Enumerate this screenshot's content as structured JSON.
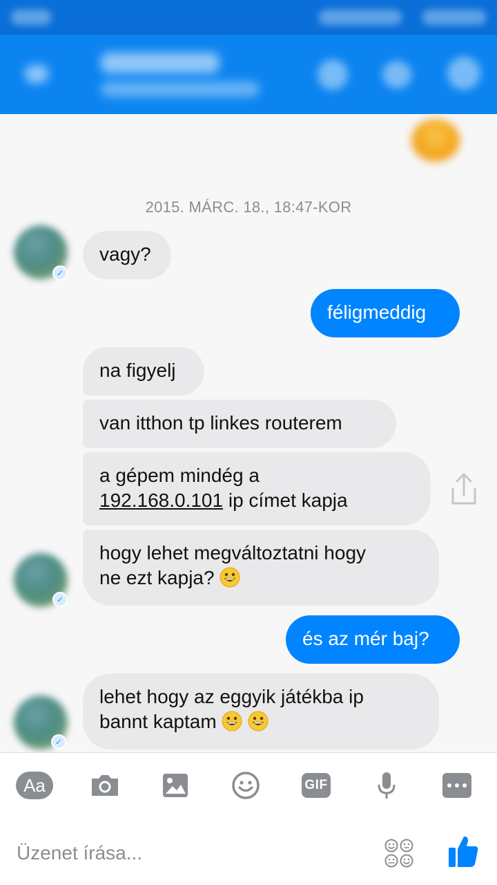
{
  "header": {
    "title": "",
    "subtitle": ""
  },
  "chat": {
    "timestamp": "2015. MÁRC. 18., 18:47-KOR",
    "messages": [
      {
        "dir": "in",
        "text": "vagy?"
      },
      {
        "dir": "out",
        "text": "féligmeddig"
      },
      {
        "dir": "in",
        "text": "na figyelj"
      },
      {
        "dir": "in",
        "text": "van itthon tp linkes routerem"
      },
      {
        "dir": "in",
        "line1": "a gépem mindég a",
        "link": "192.168.0.101",
        "line2_rest": " ip címet kapja"
      },
      {
        "dir": "in",
        "line1": "hogy lehet megváltoztatni hogy",
        "line2": "ne ezt kapja?"
      },
      {
        "dir": "out",
        "text": "és az mér baj?"
      },
      {
        "dir": "in",
        "line1": "lehet hogy az eggyik játékba ip",
        "line2": "bannt kaptam"
      }
    ]
  },
  "composer": {
    "aa_label": "Aa",
    "gif_label": "GIF",
    "placeholder": "Üzenet írása..."
  },
  "colors": {
    "accent": "#0084ff",
    "header": "#0c84f0",
    "incoming_bubble": "#e9e9eb",
    "icon_gray": "#8a8d91"
  },
  "icons": [
    "back-icon",
    "phone-icon",
    "video-icon",
    "info-icon",
    "share-icon",
    "camera-icon",
    "gallery-icon",
    "emoji-icon",
    "microphone-icon",
    "more-icon",
    "emoji-grid-icon",
    "thumbs-up-icon"
  ]
}
